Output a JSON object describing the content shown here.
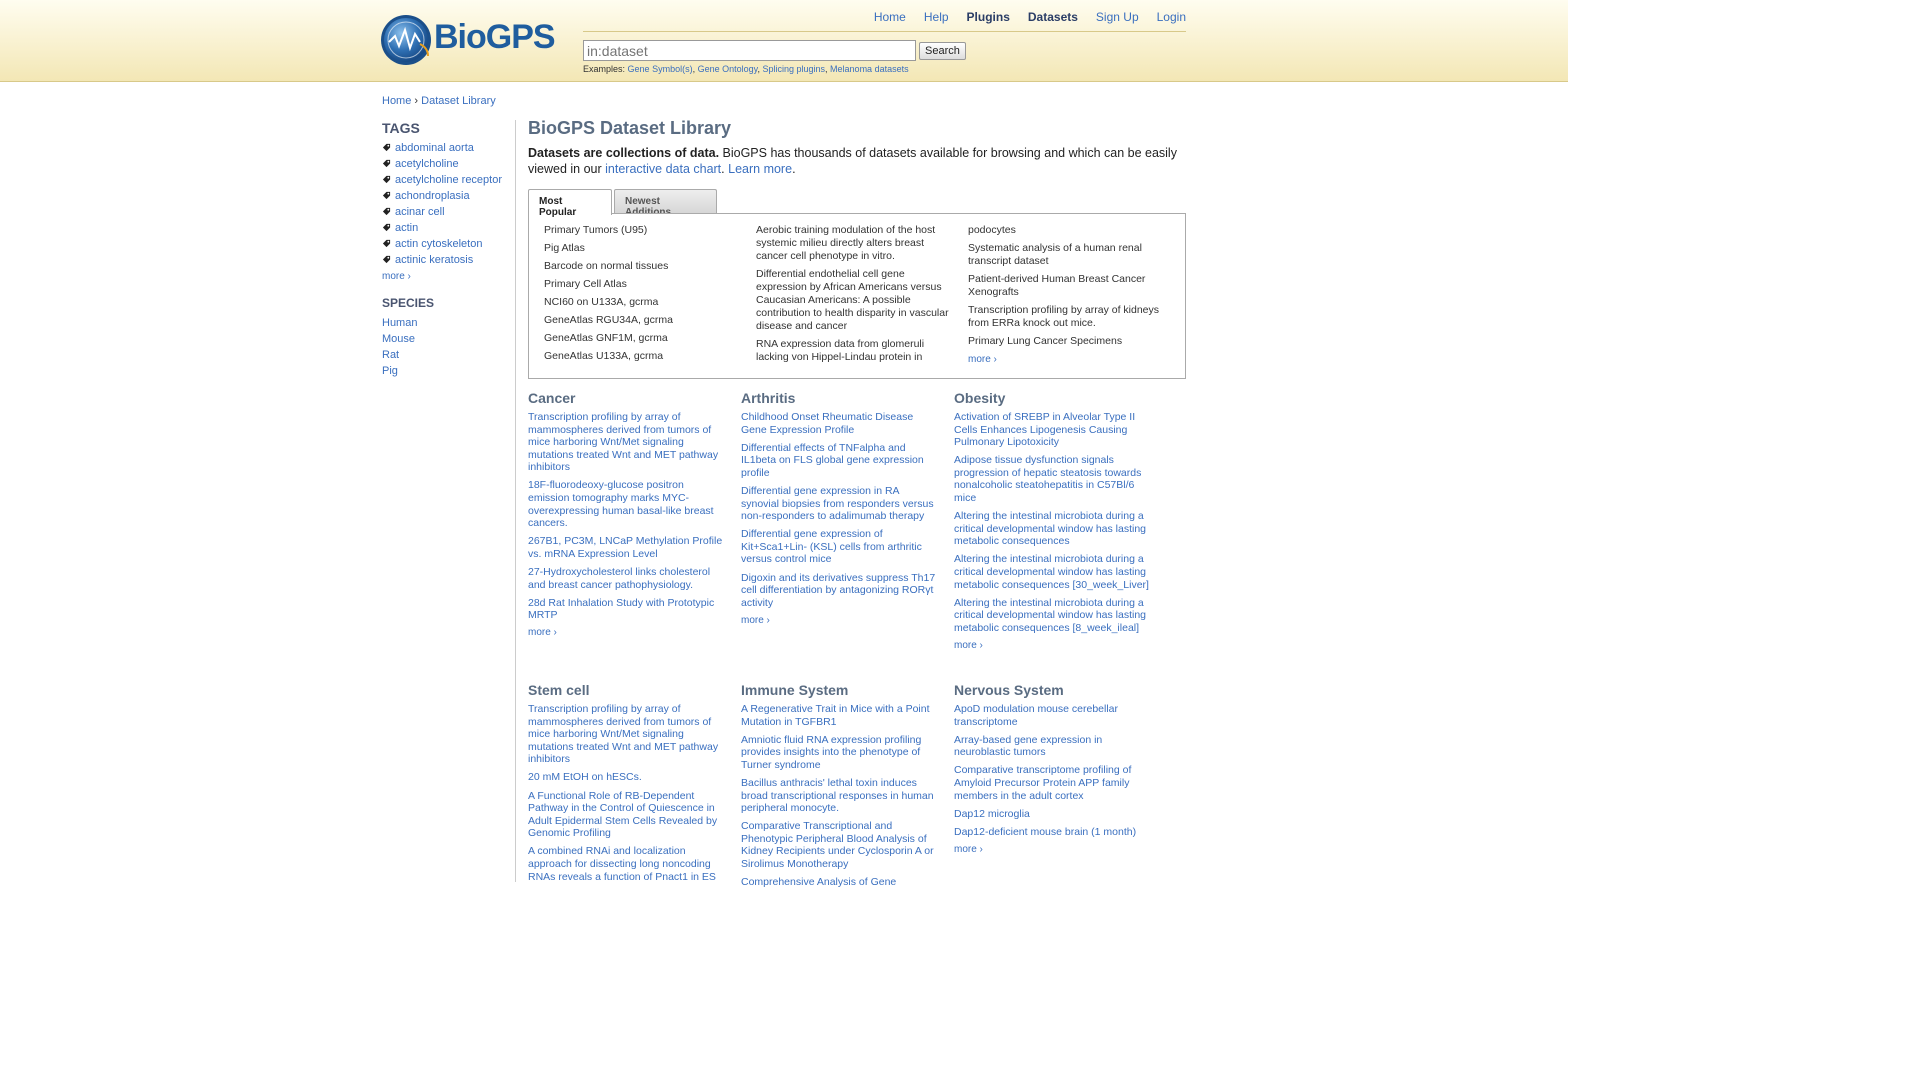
{
  "header": {
    "logo_text_bio": "Bio",
    "logo_text_gps": "GPS",
    "nav": [
      {
        "label": "Home",
        "bold": false
      },
      {
        "label": "Help",
        "bold": false
      },
      {
        "label": "Plugins",
        "bold": true
      },
      {
        "label": "Datasets",
        "bold": true
      },
      {
        "label": "Sign Up",
        "bold": false
      },
      {
        "label": "Login",
        "bold": false
      }
    ],
    "search": {
      "placeholder": "in:dataset",
      "button_label": "Search"
    },
    "examples_label": "Examples:",
    "examples": [
      "Gene Symbol(s)",
      "Gene Ontology",
      "Splicing plugins",
      "Melanoma datasets"
    ]
  },
  "breadcrumb": {
    "home": "Home",
    "separator": "›",
    "current": "Dataset Library"
  },
  "sidebar": {
    "tags_heading": "TAGS",
    "tags": [
      "abdominal aorta",
      "acetylcholine",
      "acetylcholine receptor",
      "achondroplasia",
      "acinar cell",
      "actin",
      "actin cytoskeleton",
      "actinic keratosis"
    ],
    "tags_more": "more ›",
    "species_heading": "SPECIES",
    "species": [
      "Human",
      "Mouse",
      "Rat",
      "Pig"
    ]
  },
  "main": {
    "title": "BioGPS Dataset Library",
    "intro_bold": "Datasets are collections of data.",
    "intro_text": " BioGPS has thousands of datasets available for browsing and which can be easily viewed in our ",
    "intro_link1": "interactive data chart",
    "intro_sep": ". ",
    "intro_link2": "Learn more",
    "intro_end": ".",
    "tabs": {
      "popular": "Most Popular",
      "newest": "Newest Additions"
    },
    "popular": {
      "col1": [
        "Primary Tumors (U95)",
        "Pig Atlas",
        "Barcode on normal tissues",
        "Primary Cell Atlas",
        "NCI60 on U133A, gcrma",
        "GeneAtlas RGU34A, gcrma",
        "GeneAtlas GNF1M, gcrma",
        "GeneAtlas U133A, gcrma"
      ],
      "col2": [
        "Aerobic training modulation of the host systemic milieu directly alters breast cancer cell phenotype in vitro.",
        "Differential endothelial cell gene expression by African Americans versus Caucasian Americans: A possible contribution to health disparity in vascular disease and cancer",
        "RNA expression data from glomeruli lacking von Hippel-Lindau protein in"
      ],
      "col3": [
        "podocytes",
        "Systematic analysis of a human renal transcript dataset",
        "Patient-derived Human Breast Cancer Xenografts",
        "Transcription profiling by array of kidneys from ERRa knock out mice.",
        "Primary Lung Cancer Specimens"
      ],
      "more": "more ›"
    },
    "categories": [
      {
        "title": "Cancer",
        "items": [
          "Transcription profiling by array of mammospheres derived from tumors of mice harboring Wnt/Met signaling mutations treated Wnt and MET pathway inhibitors",
          "18F-fluorodeoxy-glucose positron emission tomography marks MYC-overexpressing human basal-like breast cancers.",
          "267B1, PC3M, LNCaP Methylation Profile vs. mRNA Expression Level",
          "27-Hydroxycholesterol links cholesterol and breast cancer pathophysiology.",
          "28d Rat Inhalation Study with Prototypic MRTP"
        ],
        "more": "more ›"
      },
      {
        "title": "Arthritis",
        "items": [
          "Childhood Onset Rheumatic Disease Gene Expression Profile",
          "Differential effects of TNFalpha and IL1beta on FLS global gene expression profile",
          "Differential gene expression in RA synovial biopsies from responders versus non-responders to adalimumab therapy",
          "Differential gene expression of Kit+Sca1+Lin- (KSL) cells from arthritic versus control mice",
          "Digoxin and its derivatives suppress Th17 cell differentiation by antagonizing RORγt activity"
        ],
        "more": "more ›"
      },
      {
        "title": "Obesity",
        "items": [
          "Activation of SREBP in Alveolar Type II Cells Enhances Lipogenesis Causing Pulmonary Lipotoxicity",
          "Adipose tissue dysfunction signals progression of hepatic steatosis towards nonalcoholic steatohepatitis in C57Bl/6 mice",
          "Altering the intestinal microbiota during a critical developmental window has lasting metabolic consequences",
          "Altering the intestinal microbiota during a critical developmental window has lasting metabolic consequences [30_week_Liver]",
          "Altering the intestinal microbiota during a critical developmental window has lasting metabolic consequences [8_week_ileal]"
        ],
        "more": "more ›"
      },
      {
        "title": "Stem cell",
        "items": [
          "Transcription profiling by array of mammospheres derived from tumors of mice harboring Wnt/Met signaling mutations treated Wnt and MET pathway inhibitors",
          "20 mM EtOH on hESCs.",
          "A Functional Role of RB-Dependent Pathway in the Control of Quiescence in Adult Epidermal Stem Cells Revealed by Genomic Profiling",
          "A combined RNAi and localization approach for dissecting long noncoding RNAs reveals a function of Pnact1 in ES"
        ],
        "more": ""
      },
      {
        "title": "Immune System",
        "items": [
          "A Regenerative Trait in Mice with a Point Mutation in TGFBR1",
          "Amniotic fluid RNA expression profiling provides insights into the phenotype of Turner syndrome",
          "Bacillus anthracis' lethal toxin induces broad transcriptional responses in human peripheral monocyte.",
          "Comparative Transcriptional and Phenotypic Peripheral Blood Analysis of Kidney Recipients under Cyclosporin A or Sirolimus Monotherapy",
          "Comprehensive Analysis of Gene"
        ],
        "more": ""
      },
      {
        "title": "Nervous System",
        "items": [
          "ApoD modulation mouse cerebellar transcriptome",
          "Array-based gene expression in neuroblastic tumors",
          "Comparative transcriptome profiling of Amyloid Precursor Protein APP family members in the adult cortex",
          "Dap12 microglia",
          "Dap12-deficient mouse brain (1 month)"
        ],
        "more": "more ›"
      }
    ]
  }
}
